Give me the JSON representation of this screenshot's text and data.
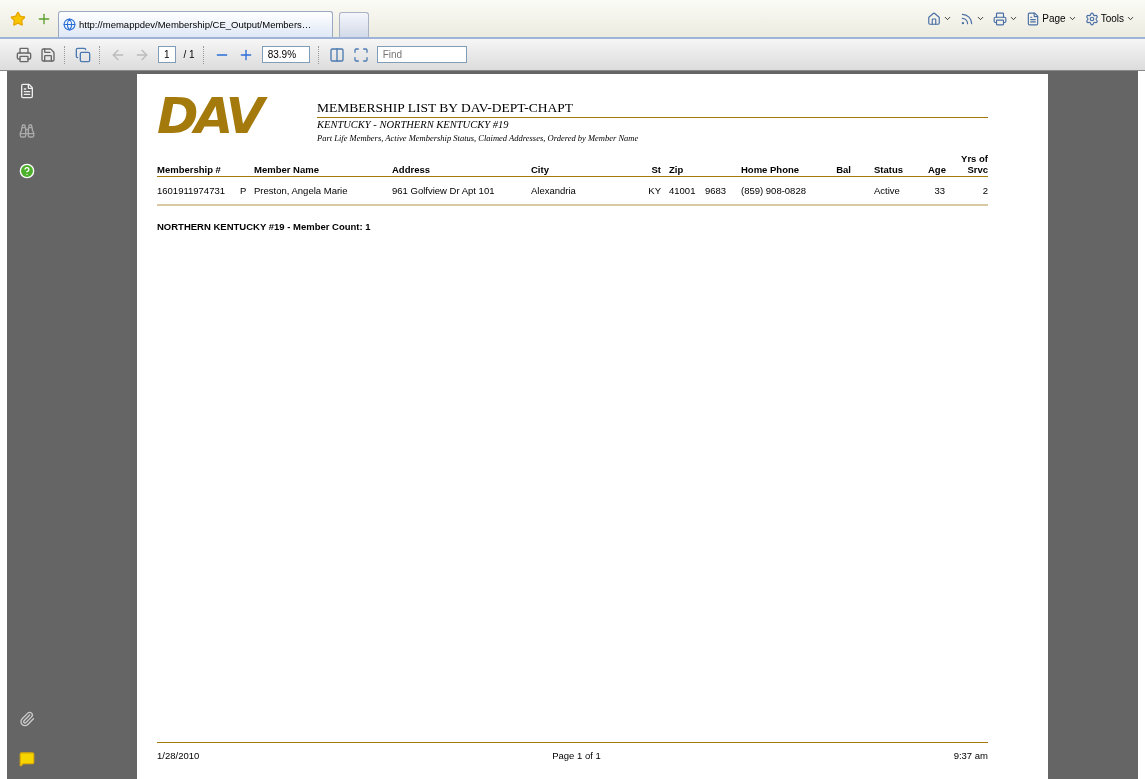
{
  "browser": {
    "tab_title": "http://memappdev/Membership/CE_Output/Members…",
    "menu": [
      {
        "kind": "home"
      },
      {
        "kind": "feed"
      },
      {
        "kind": "print"
      },
      {
        "kind": "page",
        "label": "Page"
      },
      {
        "kind": "tools",
        "label": "Tools"
      }
    ]
  },
  "viewer_toolbar": {
    "page_number": "1",
    "page_total": "/ 1",
    "zoom": "83.9%",
    "find_placeholder": "Find"
  },
  "report": {
    "logo_text": "DAV",
    "title": "MEMBERSHIP LIST BY DAV-DEPT-CHAPT",
    "subtitle": "KENTUCKY - NORTHERN KENTUCKY #19",
    "criteria": "Part Life Members, Active Membership Status, Claimed Addresses, Ordered by Member Name",
    "columns": [
      {
        "label": "Membership #"
      },
      {},
      {
        "label": "Member Name"
      },
      {
        "label": "Address"
      },
      {
        "label": "City"
      },
      {
        "label": "St"
      },
      {
        "label": "Zip"
      },
      {},
      {
        "label": "Home Phone"
      },
      {
        "label": "Bal"
      },
      {
        "label": "Status"
      },
      {
        "label": "Age"
      },
      {
        "label": "Yrs of Srvc"
      }
    ],
    "rows": [
      {
        "cells": [
          "1601911974731",
          "P",
          "Preston, Angela Marie",
          "961 Golfview Dr Apt 101",
          "Alexandria",
          "KY",
          "41001",
          "9683",
          "(859) 908-0828",
          null,
          "Active",
          "33",
          "2"
        ]
      }
    ],
    "member_count": "NORTHERN KENTUCKY #19 - Member Count: 1",
    "footer": {
      "date": "1/28/2010",
      "page": "Page 1 of 1",
      "time": "9:37 am"
    }
  }
}
